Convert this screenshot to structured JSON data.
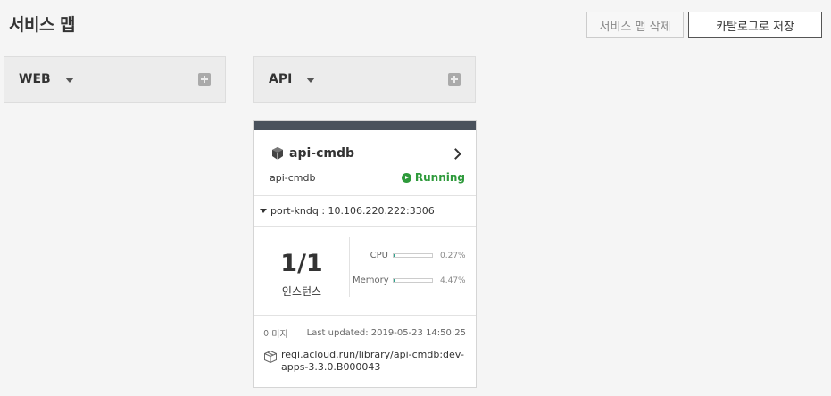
{
  "header": {
    "title": "서비스 맵",
    "delete_label": "서비스 맵 삭제",
    "save_label": "카탈로그로 저장"
  },
  "columns": [
    {
      "title": "WEB",
      "icon": "add-icon"
    },
    {
      "title": "API",
      "icon": "add-icon"
    }
  ],
  "card": {
    "name": "api-cmdb",
    "subtitle": "api-cmdb",
    "status": "Running",
    "status_color": "#2e9a3b",
    "port": "port-kndq : 10.106.220.222:3306",
    "instances": "1/1",
    "instances_label": "인스턴스",
    "cpu_label": "CPU",
    "cpu_value": "0.27%",
    "cpu_fraction": 0.0027,
    "memory_label": "Memory",
    "memory_value": "4.47%",
    "memory_fraction": 0.0447,
    "image_label": "이미지",
    "last_updated": "Last updated: 2019-05-23 14:50:25",
    "image_path": "regi.acloud.run/library/api-cmdb:dev-apps-3.3.0.B000043"
  },
  "colors": {
    "header_bar": "#4a525c",
    "accent": "#2aa58d"
  }
}
